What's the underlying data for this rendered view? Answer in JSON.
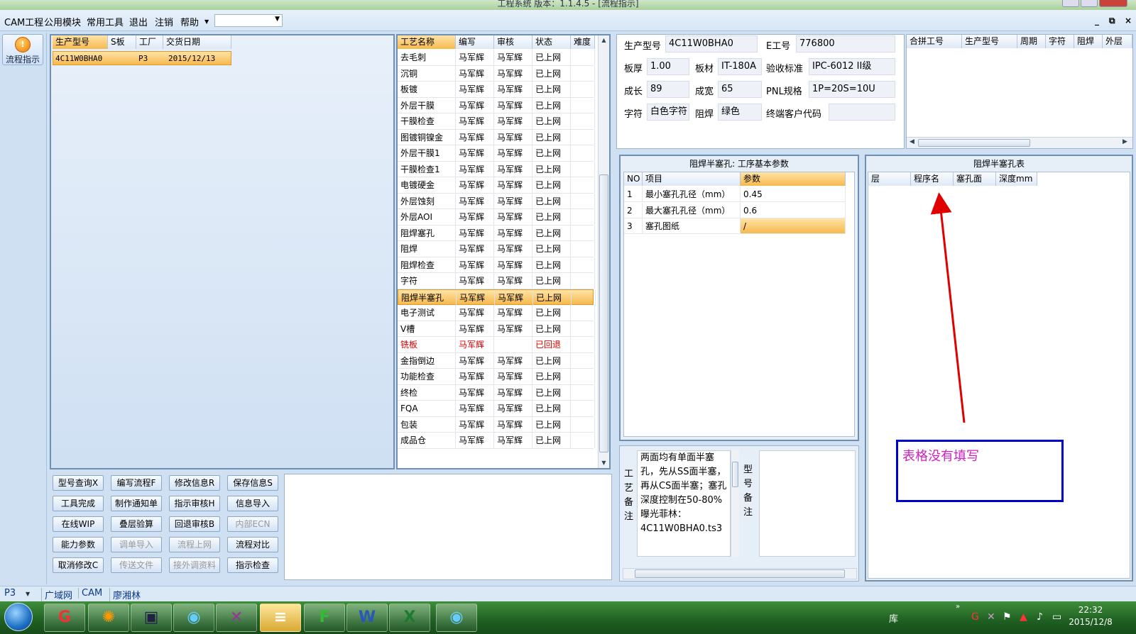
{
  "window": {
    "title": "工程系统  版本：1.1.4.5 - [流程指示]"
  },
  "menu": [
    "CAM工程",
    "公用模块",
    "常用工具",
    "退出",
    "注销",
    "帮助"
  ],
  "mdi": [
    "_",
    "⧉",
    "×"
  ],
  "leftnav": {
    "flow_label": "流程指示"
  },
  "order_list": {
    "headers": [
      "生产型号",
      "S板",
      "工厂",
      "交货日期"
    ],
    "row": [
      "4C11W0BHA0",
      "",
      "P3",
      "2015/12/13"
    ]
  },
  "process": {
    "headers": [
      "工艺名称",
      "编写",
      "审核",
      "状态",
      "难度"
    ],
    "rows": [
      [
        "去毛刺",
        "马军辉",
        "马军辉",
        "已上网"
      ],
      [
        "沉铜",
        "马军辉",
        "马军辉",
        "已上网"
      ],
      [
        "板镀",
        "马军辉",
        "马军辉",
        "已上网"
      ],
      [
        "外层干膜",
        "马军辉",
        "马军辉",
        "已上网"
      ],
      [
        "干膜检查",
        "马军辉",
        "马军辉",
        "已上网"
      ],
      [
        "图镀铜镍金",
        "马军辉",
        "马军辉",
        "已上网"
      ],
      [
        "外层干膜1",
        "马军辉",
        "马军辉",
        "已上网"
      ],
      [
        "干膜检查1",
        "马军辉",
        "马军辉",
        "已上网"
      ],
      [
        "电镀硬金",
        "马军辉",
        "马军辉",
        "已上网"
      ],
      [
        "外层蚀刻",
        "马军辉",
        "马军辉",
        "已上网"
      ],
      [
        "外层AOI",
        "马军辉",
        "马军辉",
        "已上网"
      ],
      [
        "阻焊塞孔",
        "马军辉",
        "马军辉",
        "已上网"
      ],
      [
        "阻焊",
        "马军辉",
        "马军辉",
        "已上网"
      ],
      [
        "阻焊检查",
        "马军辉",
        "马军辉",
        "已上网"
      ],
      [
        "字符",
        "马军辉",
        "马军辉",
        "已上网"
      ],
      [
        "阻焊半塞孔",
        "马军辉",
        "马军辉",
        "已上网"
      ],
      [
        "电子测试",
        "马军辉",
        "马军辉",
        "已上网"
      ],
      [
        "V槽",
        "马军辉",
        "马军辉",
        "已上网"
      ],
      [
        "铣板",
        "马军辉",
        "",
        "已回退"
      ],
      [
        "金指倒边",
        "马军辉",
        "马军辉",
        "已上网"
      ],
      [
        "功能检查",
        "马军辉",
        "马军辉",
        "已上网"
      ],
      [
        "终检",
        "马军辉",
        "马军辉",
        "已上网"
      ],
      [
        "FQA",
        "马军辉",
        "马军辉",
        "已上网"
      ],
      [
        "包装",
        "马军辉",
        "马军辉",
        "已上网"
      ],
      [
        "成品仓",
        "马军辉",
        "马军辉",
        "已上网"
      ]
    ]
  },
  "buttons": [
    [
      "型号查询X",
      "编写流程F",
      "修改信息R",
      "保存信息S"
    ],
    [
      "工具完成",
      "制作通知单",
      "指示审核H",
      "信息导入"
    ],
    [
      "在线WIP",
      "叠层验算",
      "回退审核B",
      "内部ECN"
    ],
    [
      "能力参数",
      "调单导入",
      "流程上网",
      "流程对比"
    ],
    [
      "取消修改C",
      "传送文件",
      "接外调资料",
      "指示检查"
    ]
  ],
  "disabled_buttons": [
    "内部ECN",
    "调单导入",
    "流程上网",
    "传送文件",
    "接外调资料"
  ],
  "info": {
    "prod_model_label": "生产型号",
    "prod_model": "4C11W0BHA0",
    "eno_label": "E工号",
    "eno": "776800",
    "thick_label": "板厚",
    "thick": "1.00",
    "mat_label": "板材",
    "mat": "IT-180A",
    "std_label": "验收标准",
    "std": "IPC-6012 II级",
    "len_label": "成长",
    "len": "89",
    "wid_label": "成宽",
    "wid": "65",
    "pnl_label": "PNL规格",
    "pnl": "1P=20S=10U",
    "char_label": "字符",
    "char": "白色字符",
    "mask_label": "阻焊",
    "mask": "绿色",
    "cust_label": "终端客户代码",
    "cust": ""
  },
  "merge_table": {
    "headers": [
      "合拼工号",
      "生产型号",
      "周期",
      "字符",
      "阻焊",
      "外层"
    ]
  },
  "params": {
    "title": "阻焊半塞孔: 工序基本参数",
    "headers": [
      "NO",
      "项目",
      "参数"
    ],
    "rows": [
      [
        "1",
        "最小塞孔孔径（mm）",
        "0.45"
      ],
      [
        "2",
        "最大塞孔孔径（mm）",
        "0.6"
      ],
      [
        "3",
        "塞孔图纸",
        "/"
      ]
    ]
  },
  "plug_table": {
    "title": "阻焊半塞孔表",
    "headers": [
      "层",
      "程序名",
      "塞孔面",
      "深度mm"
    ]
  },
  "note": {
    "label": "工艺备注",
    "text": "两面均有单面半塞孔，先从SS面半塞，再从CS面半塞；塞孔深度控制在50-80%\n曝光菲林：\n4C11W0BHA0.ts3",
    "label2": "型号备注"
  },
  "annotation": {
    "text": "表格没有填写"
  },
  "status": {
    "items": [
      "P3",
      "广域网",
      "CAM",
      "廖湘林"
    ]
  },
  "taskbar": {
    "tray_lib": "库",
    "time": "22:32",
    "date": "2015/12/8"
  },
  "colors": {
    "accent": "#f6b94e",
    "annotation_border": "#0000cc",
    "annotation_text": "#d020c0",
    "arrow": "#e00000"
  }
}
